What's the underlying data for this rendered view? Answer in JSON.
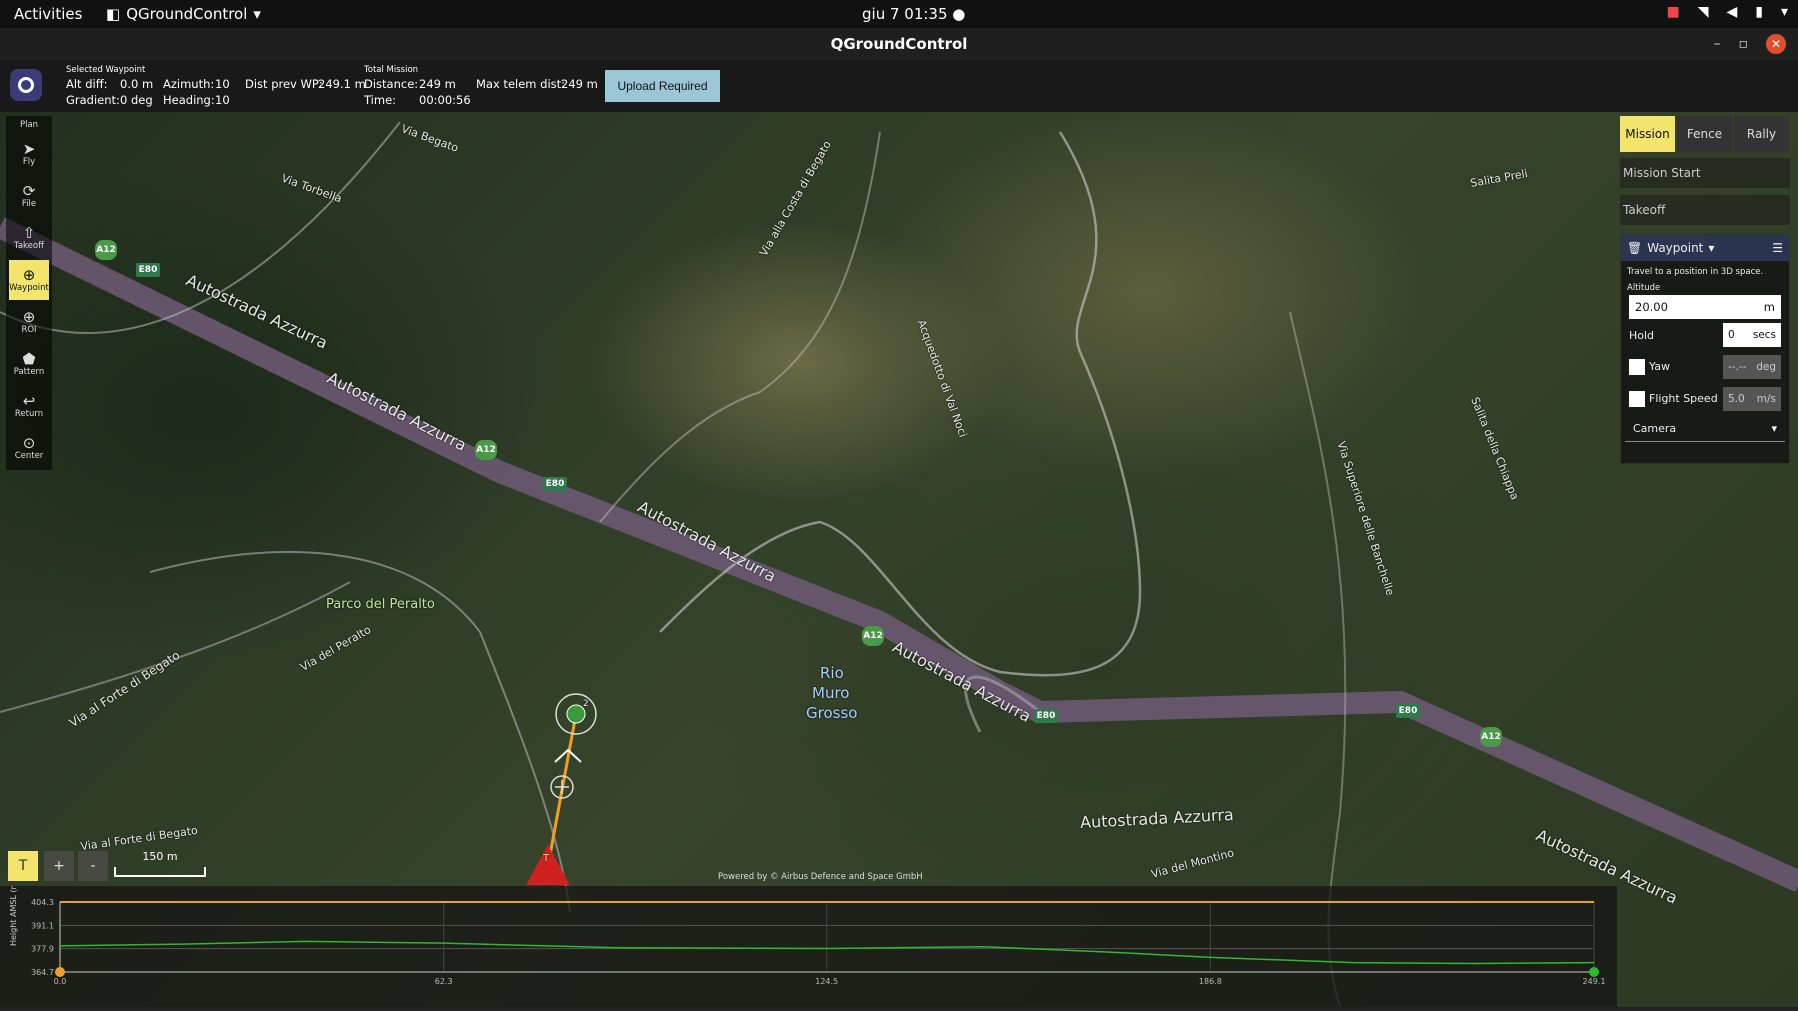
{
  "system_bar": {
    "activities": "Activities",
    "app_name": "QGroundControl",
    "clock": "giu 7  01:35"
  },
  "window": {
    "title": "QGroundControl"
  },
  "mission_header": {
    "selected_waypoint_label": "Selected Waypoint",
    "alt_diff_label": "Alt diff:",
    "alt_diff_value": "0.0 m",
    "azimuth_label": "Azimuth:",
    "azimuth_value": "10",
    "dist_prev_wp_label": "Dist prev WP:",
    "dist_prev_wp_value": "249.1 m",
    "gradient_label": "Gradient:",
    "gradient_value": "0 deg",
    "heading_label": "Heading:",
    "heading_value": "10",
    "total_mission_label": "Total Mission",
    "distance_label": "Distance:",
    "distance_value": "249 m",
    "time_label": "Time:",
    "time_value": "00:00:56",
    "max_telem_label": "Max telem dist:",
    "max_telem_value": "249 m",
    "upload_button": "Upload Required"
  },
  "toolbar": {
    "items": [
      {
        "label": "Plan",
        "icon": ""
      },
      {
        "label": "Fly",
        "icon": "paper-plane-icon"
      },
      {
        "label": "File",
        "icon": "file-icon"
      },
      {
        "label": "Takeoff",
        "icon": "takeoff-icon"
      },
      {
        "label": "Waypoint",
        "icon": "waypoint-icon"
      },
      {
        "label": "ROI",
        "icon": "roi-icon"
      },
      {
        "label": "Pattern",
        "icon": "pattern-icon"
      },
      {
        "label": "Return",
        "icon": "return-icon"
      },
      {
        "label": "Center",
        "icon": "center-icon"
      }
    ],
    "active": "Waypoint"
  },
  "right_panel": {
    "tabs": [
      "Mission",
      "Fence",
      "Rally"
    ],
    "active_tab": "Mission",
    "mission_start": "Mission Start",
    "takeoff": "Takeoff",
    "waypoint": {
      "title": "Waypoint",
      "description": "Travel to a position in 3D space.",
      "altitude_label": "Altitude",
      "altitude_value": "20.00",
      "altitude_unit": "m",
      "hold_label": "Hold",
      "hold_value": "0",
      "hold_unit": "secs",
      "yaw_label": "Yaw",
      "yaw_value": "--.--",
      "yaw_unit": "deg",
      "speed_label": "Flight Speed",
      "speed_value": "5.0",
      "speed_unit": "m/s",
      "camera_label": "Camera"
    }
  },
  "map": {
    "labels": {
      "autostrada1": "Autostrada Azzurra",
      "autostrada2": "Autostrada Azzurra",
      "autostrada3": "Autostrada Azzurra",
      "autostrada4": "Autostrada Azzurra",
      "autostrada5": "Autostrada Azzurra",
      "autostrada6": "Autostrada Azzurra",
      "parco": "Parco del Peralto",
      "rio1": "Rio",
      "rio2": "Muro",
      "rio3": "Grosso",
      "via_begato": "Via Begato",
      "via_torbella": "Via Torbella",
      "via_costa": "Via alla Costa di Begato",
      "via_forte": "Via al Forte di Begato",
      "via_peralto": "Via del Peralto",
      "acquedotto": "Acquedotto di Val Noci",
      "salita_preli": "Salita Preli",
      "salita_chiappa": "Salita della Chiappa",
      "via_superiore": "Via Superiore delle Banchelle",
      "via_montino": "Via del Montino",
      "via_forte2": "Via al Forte di Begato",
      "a12": "A12",
      "e80": "E80"
    },
    "scale_label": "150 m",
    "attribution": "Powered by © Airbus Defence and Space GmbH",
    "home_marker": "T",
    "waypoint_marker": "2",
    "ctrl_labels": [
      "T",
      "+",
      "-"
    ]
  },
  "elevation_chart": {
    "y_axis_label": "Height AMSL (m)",
    "y_ticks": [
      "404.3",
      "391.1",
      "377.9",
      "364.7"
    ],
    "x_ticks": [
      "0.0",
      "62.3",
      "124.5",
      "186.8",
      "249.1"
    ]
  },
  "chart_data": {
    "type": "line",
    "xlabel": "",
    "ylabel": "Height AMSL (m)",
    "xlim": [
      0,
      249.1
    ],
    "ylim": [
      364.7,
      404.3
    ],
    "series": [
      {
        "values": [
          [
            0,
            379.5
          ],
          [
            20,
            380.5
          ],
          [
            40,
            382
          ],
          [
            62.3,
            381
          ],
          [
            90,
            378.5
          ],
          [
            124.5,
            378
          ],
          [
            150,
            379
          ],
          [
            170,
            376
          ],
          [
            186.8,
            373
          ],
          [
            210,
            370
          ],
          [
            230,
            369.5
          ],
          [
            249.1,
            370
          ]
        ]
      },
      {
        "values": [
          [
            0,
            404.3
          ],
          [
            249.1,
            404.3
          ]
        ]
      }
    ]
  }
}
